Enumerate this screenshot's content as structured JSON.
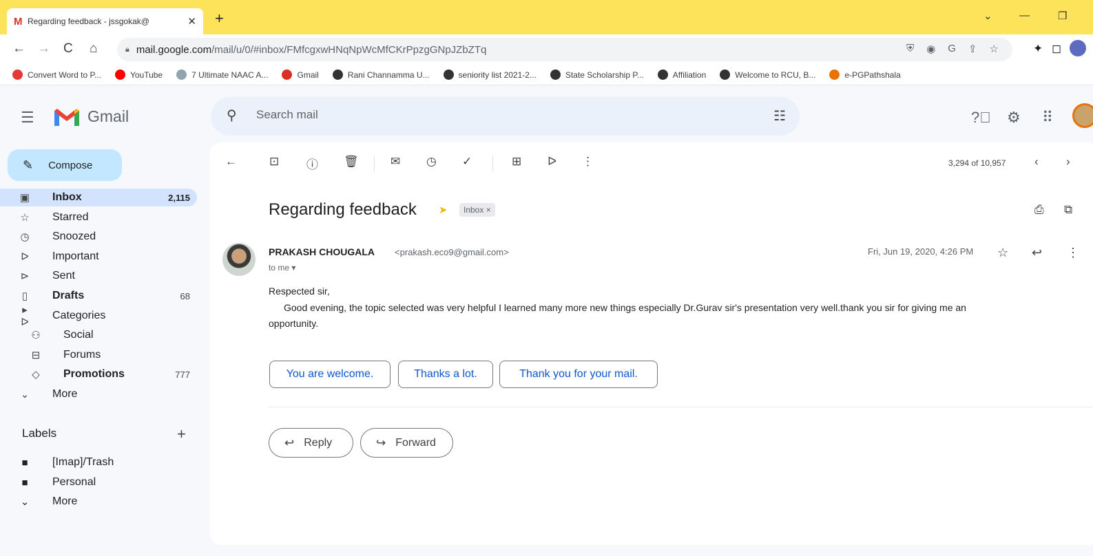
{
  "browser": {
    "tab_title": "Regarding feedback - jssgokak@",
    "tab_favicon": "M",
    "url_host": "mail.google.com",
    "url_path": "/mail/u/0/#inbox/FMfcgxwHNqNpWcMfCKrPpzgGNpJZbZTq",
    "bookmarks": [
      {
        "label": "Convert Word to P...",
        "icon": "heart-icon",
        "color": "#e53935"
      },
      {
        "label": "YouTube",
        "icon": "youtube-icon",
        "color": "#ff0000"
      },
      {
        "label": "7 Ultimate NAAC A...",
        "icon": "loading-icon",
        "color": "#90a4ae"
      },
      {
        "label": "Gmail",
        "icon": "gmail-icon",
        "color": "#d93025"
      },
      {
        "label": "Rani Channamma U...",
        "icon": "globe-icon",
        "color": "#333333"
      },
      {
        "label": "seniority list 2021-2...",
        "icon": "globe-icon",
        "color": "#333333"
      },
      {
        "label": "State Scholarship P...",
        "icon": "globe-icon",
        "color": "#333333"
      },
      {
        "label": "Affiliation",
        "icon": "globe-icon",
        "color": "#333333"
      },
      {
        "label": "Welcome to RCU, B...",
        "icon": "globe-icon",
        "color": "#333333"
      },
      {
        "label": "e-PGPathshala",
        "icon": "epg-icon",
        "color": "#e8710a"
      }
    ]
  },
  "gmail": {
    "brand": "Gmail",
    "search_placeholder": "Search mail",
    "compose_label": "Compose",
    "nav": [
      {
        "label": "Inbox",
        "count": "2,115",
        "icon": "inbox-icon",
        "glyph": "▣",
        "bold": true,
        "active": true
      },
      {
        "label": "Starred",
        "count": "",
        "icon": "star-icon",
        "glyph": "☆",
        "bold": false
      },
      {
        "label": "Snoozed",
        "count": "",
        "icon": "clock-icon",
        "glyph": "◷",
        "bold": false
      },
      {
        "label": "Important",
        "count": "",
        "icon": "important-icon",
        "glyph": "ᐅ",
        "bold": false
      },
      {
        "label": "Sent",
        "count": "",
        "icon": "send-icon",
        "glyph": "⊳",
        "bold": false
      },
      {
        "label": "Drafts",
        "count": "68",
        "icon": "draft-icon",
        "glyph": "▯",
        "bold": true
      },
      {
        "label": "Categories",
        "count": "",
        "icon": "label-icon",
        "glyph": "▸ ᐅ",
        "bold": false
      },
      {
        "label": "Social",
        "count": "",
        "icon": "people-icon",
        "glyph": "⚇",
        "bold": false,
        "indent": true
      },
      {
        "label": "Forums",
        "count": "",
        "icon": "forum-icon",
        "glyph": "⊟",
        "bold": false,
        "indent": true
      },
      {
        "label": "Promotions",
        "count": "777",
        "icon": "tag-icon",
        "glyph": "◇",
        "bold": true,
        "indent": true
      },
      {
        "label": "More",
        "count": "",
        "icon": "chevron-down-icon",
        "glyph": "⌄",
        "bold": false
      }
    ],
    "labels_title": "Labels",
    "labels": [
      {
        "label": "[Imap]/Trash",
        "icon": "label-filled-icon",
        "glyph": "■"
      },
      {
        "label": "Personal",
        "icon": "label-filled-icon",
        "glyph": "■"
      },
      {
        "label": "More",
        "icon": "chevron-down-icon",
        "glyph": "⌄"
      }
    ]
  },
  "message": {
    "pager": "3,294 of 10,957",
    "subject": "Regarding feedback",
    "inbox_chip": "Inbox ×",
    "sender_name": "PRAKASH CHOUGALA",
    "sender_email": "<prakash.eco9@gmail.com>",
    "to": "to me ▾",
    "date": "Fri, Jun 19, 2020, 4:26 PM",
    "greeting": "Respected sir,",
    "body_line1": "Good evening, the topic selected was very helpful I learned many more new things especially Dr.Gurav sir's presentation very well.thank you sir for giving me an",
    "body_line2": "opportunity.",
    "smart_replies": [
      "You are welcome.",
      "Thanks a lot.",
      "Thank you for your mail."
    ],
    "reply_label": "Reply",
    "forward_label": "Forward"
  }
}
